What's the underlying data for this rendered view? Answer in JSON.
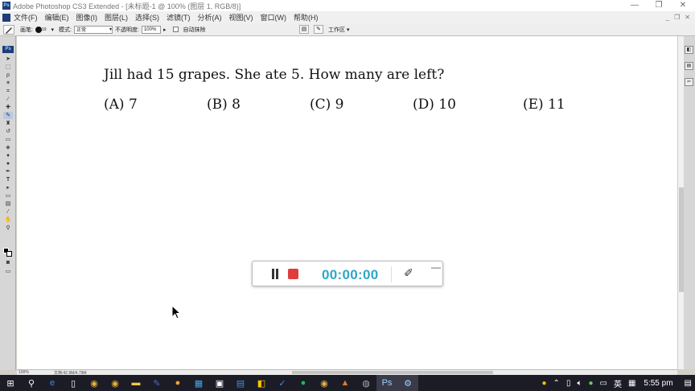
{
  "window": {
    "app_badge": "Ps",
    "title": "Adobe Photoshop CS3 Extended - [未标题-1 @ 100% (图层 1, RGB/8)]",
    "controls": [
      "—",
      "❐",
      "✕"
    ]
  },
  "menubar": {
    "items": [
      "文件(F)",
      "编辑(E)",
      "图像(I)",
      "图层(L)",
      "选择(S)",
      "滤镜(T)",
      "分析(A)",
      "视图(V)",
      "窗口(W)",
      "帮助(H)"
    ],
    "doc_controls": [
      "_",
      "❐",
      "✕"
    ]
  },
  "options_bar": {
    "brush_label": "画笔:",
    "brush_size": "19",
    "mode_label": "模式:",
    "mode_value": "正常",
    "opacity_label": "不透明度:",
    "opacity_value": "100%",
    "auto_erase_label": "自动抹除",
    "workspace_label": "工作区 ▾"
  },
  "document": {
    "question": "Jill had 15 grapes. She ate 5. How many are left?",
    "choices": [
      "(A) 7",
      "(B) 8",
      "(C) 9",
      "(D) 10",
      "(E) 11"
    ]
  },
  "recorder": {
    "time": "00:00:00",
    "stop_color": "#e03c3c",
    "time_color": "#2fa7c6"
  },
  "statusbar": {
    "zoom": "100%",
    "doc_info": "文档:42.9M/4.79M"
  },
  "taskbar": {
    "icons": [
      "windows-icon",
      "search-icon",
      "edge-icon",
      "file-icon",
      "chrome-icon",
      "chrome-icon",
      "folder-icon",
      "pen-app-icon",
      "chat-icon",
      "calculator-icon",
      "app-icon",
      "explorer-icon",
      "app-icon",
      "music-icon",
      "chrome-icon",
      "app-icon",
      "app-icon",
      "photoshop-icon",
      "app-icon"
    ],
    "tray": {
      "ime": "英",
      "time": "5:55 pm"
    }
  }
}
